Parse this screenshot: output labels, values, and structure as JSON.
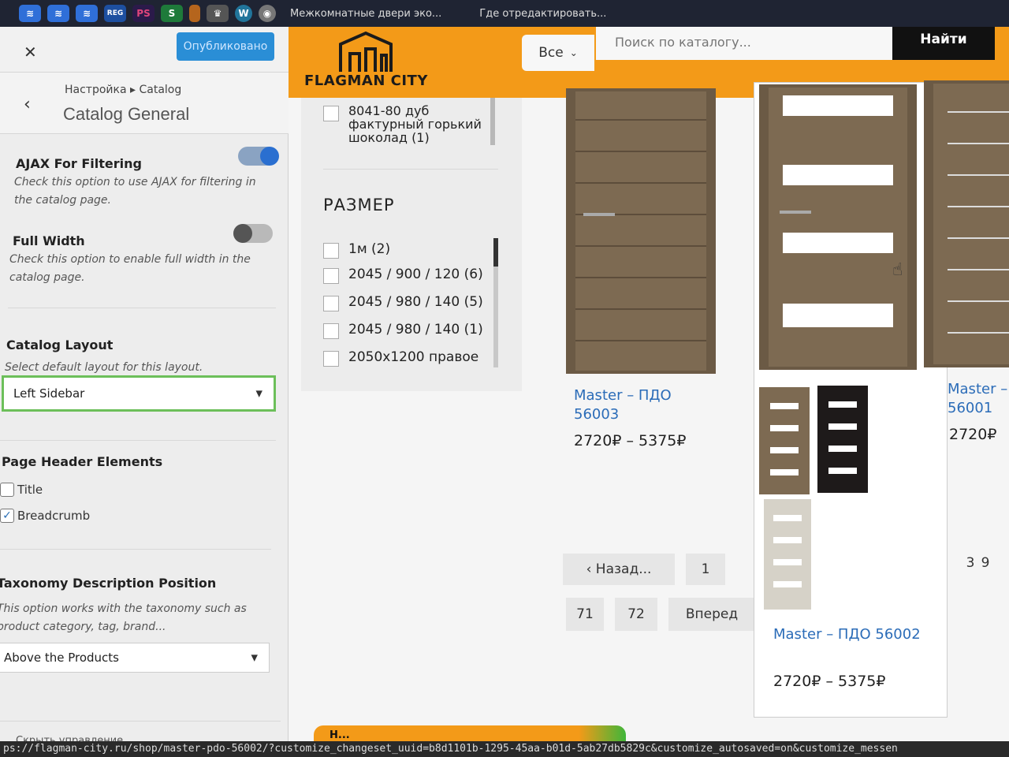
{
  "browser": {
    "tab_title": "Межкомнатные двери эко...",
    "tab_title_2": "Где отредактировать...",
    "status_url": "ps://flagman-city.ru/shop/master-pdo-56002/?customize_changeset_uuid=b8d1101b-1295-45aa-b01d-5ab27db5829c&customize_autosaved=on&customize_messen"
  },
  "dock": {
    "icons": [
      {
        "name": "app-icon",
        "label": "",
        "color": "#2f6fd8"
      },
      {
        "name": "app-icon",
        "label": "",
        "color": "#2f6fd8"
      },
      {
        "name": "app-icon",
        "label": "",
        "color": "#2f6fd8"
      },
      {
        "name": "reg-icon",
        "label": "REG",
        "color": "#1d4fa0"
      },
      {
        "name": "photoshop-icon",
        "label": "PS",
        "color": "#2b1a4a"
      },
      {
        "name": "s-icon",
        "label": "S",
        "color": "#1e7a3a"
      },
      {
        "name": "book-icon",
        "label": "",
        "color": "#b5651d"
      },
      {
        "name": "crown-icon",
        "label": "",
        "color": "#555"
      },
      {
        "name": "wordpress-icon",
        "label": "W",
        "color": "#21759b"
      },
      {
        "name": "circle-icon",
        "label": "",
        "color": "#777"
      }
    ]
  },
  "customizer": {
    "close_label": "✕",
    "publish_label": "Опубликовано",
    "back_label": "‹",
    "breadcrumb": "Настройка ▸ Catalog",
    "section_title": "Catalog General",
    "ajax": {
      "title": "AJAX For Filtering",
      "desc": "Check this option to use AJAX for filtering in the catalog page.",
      "enabled": true
    },
    "full_width": {
      "title": "Full Width",
      "desc": "Check this option to enable full width in the catalog page.",
      "enabled": false
    },
    "catalog_layout": {
      "title": "Catalog Layout",
      "desc": "Select default layout for this layout.",
      "value": "Left Sidebar"
    },
    "page_header": {
      "title": "Page Header Elements",
      "items": [
        {
          "label": "Title",
          "checked": false
        },
        {
          "label": "Breadcrumb",
          "checked": true
        }
      ]
    },
    "taxonomy": {
      "title": "Taxonomy Description Position",
      "desc": "This option works with the taxonomy such as product category, tag, brand...",
      "value": "Above the Products"
    },
    "footer_hint": "Скрыть управление"
  },
  "site": {
    "logo_text": "FLAGMAN CITY",
    "search": {
      "category": "Все",
      "placeholder": "Поиск по каталогу...",
      "button": "Найти"
    },
    "filter": {
      "top_item": "8041-80 дуб фактурный горький шоколад (1)",
      "heading": "РАЗМЕР",
      "items": [
        "1м (2)",
        "2045 / 900 / 120 (6)",
        "2045 / 980 / 140 (5)",
        "2045 / 980 / 140 (1)",
        "2050x1200 правое"
      ]
    },
    "products": [
      {
        "name": "Master – ПДО 56003",
        "price": "2720₽ – 5375₽"
      },
      {
        "name": "Master – ПДО 56002",
        "price": "2720₽ – 5375₽"
      },
      {
        "name": "Master – 56001",
        "price": "2720₽"
      }
    ],
    "pagination": {
      "prev": "‹ Назад...",
      "pages": [
        "1",
        "3",
        "9",
        "71",
        "72"
      ],
      "next": "Вперед"
    },
    "notice": "Н..."
  }
}
